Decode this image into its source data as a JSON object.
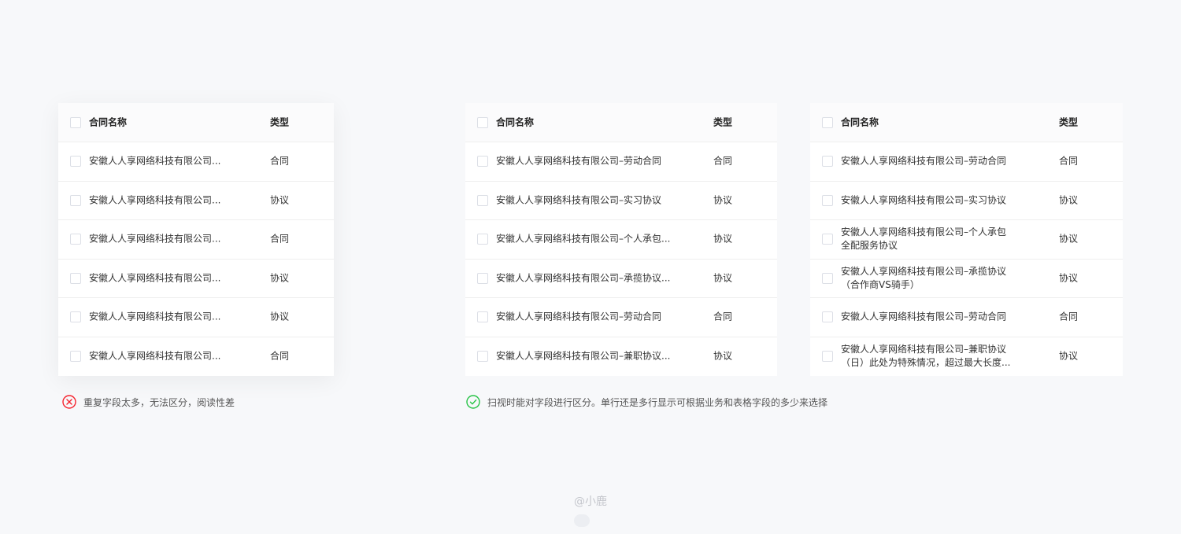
{
  "tables": [
    {
      "header": {
        "name": "合同名称",
        "type": "类型"
      },
      "rows": [
        {
          "name": "安徽人人享网络科技有限公司...",
          "type": "合同"
        },
        {
          "name": "安徽人人享网络科技有限公司...",
          "type": "协议"
        },
        {
          "name": "安徽人人享网络科技有限公司...",
          "type": "合同"
        },
        {
          "name": "安徽人人享网络科技有限公司...",
          "type": "协议"
        },
        {
          "name": "安徽人人享网络科技有限公司...",
          "type": "协议"
        },
        {
          "name": "安徽人人享网络科技有限公司...",
          "type": "合同"
        }
      ]
    },
    {
      "header": {
        "name": "合同名称",
        "type": "类型"
      },
      "rows": [
        {
          "name": "安徽人人享网络科技有限公司–劳动合同",
          "type": "合同"
        },
        {
          "name": "安徽人人享网络科技有限公司–实习协议",
          "type": "协议"
        },
        {
          "name": "安徽人人享网络科技有限公司–个人承包...",
          "type": "协议"
        },
        {
          "name": "安徽人人享网络科技有限公司–承揽协议...",
          "type": "协议"
        },
        {
          "name": "安徽人人享网络科技有限公司–劳动合同",
          "type": "合同"
        },
        {
          "name": "安徽人人享网络科技有限公司–兼职协议...",
          "type": "协议"
        }
      ]
    },
    {
      "header": {
        "name": "合同名称",
        "type": "类型"
      },
      "rows": [
        {
          "line1": "安徽人人享网络科技有限公司–劳动合同",
          "line2": "",
          "type": "合同"
        },
        {
          "line1": "安徽人人享网络科技有限公司–实习协议",
          "line2": "",
          "type": "协议"
        },
        {
          "line1": "安徽人人享网络科技有限公司–个人承包",
          "line2": "全配服务协议",
          "type": "协议"
        },
        {
          "line1": "安徽人人享网络科技有限公司–承揽协议",
          "line2": "（合作商VS骑手）",
          "type": "协议"
        },
        {
          "line1": "安徽人人享网络科技有限公司–劳动合同",
          "line2": "",
          "type": "合同"
        },
        {
          "line1": "安徽人人享网络科技有限公司–兼职协议",
          "line2": "（日）此处为特殊情况，超过最大长度...",
          "type": "协议"
        }
      ]
    }
  ],
  "notes": {
    "bad": {
      "text": "重复字段太多，无法区分，阅读性差",
      "icon": "error-circle-icon",
      "color": "#f5222d"
    },
    "good": {
      "text": "扫视时能对字段进行区分。单行还是多行显示可根据业务和表格字段的多少来选择",
      "icon": "check-circle-icon",
      "color": "#27c346"
    }
  },
  "watermark": "@小鹿"
}
